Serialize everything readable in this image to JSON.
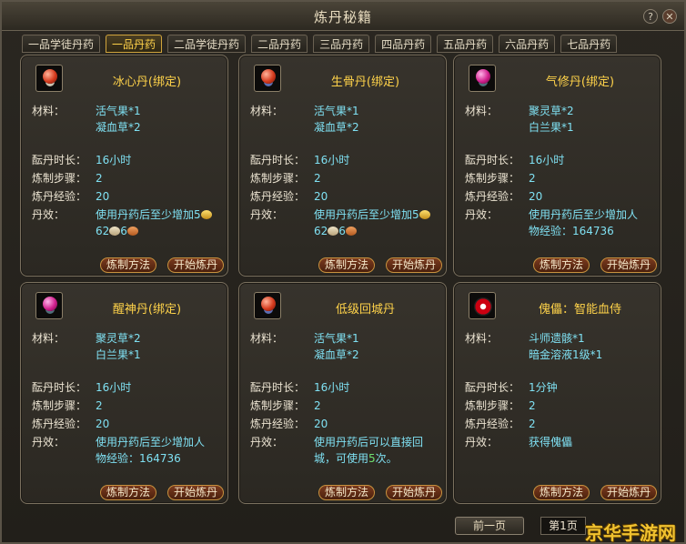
{
  "window": {
    "title": "炼丹秘籍"
  },
  "tabs": [
    {
      "label": "一品学徒丹药",
      "active": false
    },
    {
      "label": "一品丹药",
      "active": true
    },
    {
      "label": "二品学徒丹药",
      "active": false
    },
    {
      "label": "二品丹药",
      "active": false
    },
    {
      "label": "三品丹药",
      "active": false
    },
    {
      "label": "四品丹药",
      "active": false
    },
    {
      "label": "五品丹药",
      "active": false
    },
    {
      "label": "六品丹药",
      "active": false
    },
    {
      "label": "七品丹药",
      "active": false
    }
  ],
  "labels": {
    "materials": "材料：",
    "duration": "酝丹时长：",
    "steps": "炼制步骤：",
    "exp": "炼丹经验：",
    "effect": "丹效：",
    "method_button": "炼制方法",
    "start_button": "开始炼丹"
  },
  "recipes": [
    {
      "name": "冰心丹(绑定)",
      "icon": "red-pill-icon",
      "materials": [
        "活气果*1",
        "凝血草*2"
      ],
      "duration": "16小时",
      "steps": "2",
      "exp": "20",
      "effect_line1": "使用丹药后至少增加5",
      "effect_line2_a": "62",
      "effect_line2_b": "6"
    },
    {
      "name": "生骨丹(绑定)",
      "icon": "red-pill-icon",
      "materials": [
        "活气果*1",
        "凝血草*2"
      ],
      "duration": "16小时",
      "steps": "2",
      "exp": "20",
      "effect_line1": "使用丹药后至少增加5",
      "effect_line2_a": "62",
      "effect_line2_b": "6"
    },
    {
      "name": "气修丹(绑定)",
      "icon": "pink-pill-icon",
      "materials": [
        "聚灵草*2",
        "白兰果*1"
      ],
      "duration": "16小时",
      "steps": "2",
      "exp": "20",
      "effect_line1": "使用丹药后至少增加人",
      "effect_line2": "物经验：164736"
    },
    {
      "name": "醒神丹(绑定)",
      "icon": "pink-pill-icon",
      "materials": [
        "聚灵草*2",
        "白兰果*1"
      ],
      "duration": "16小时",
      "steps": "2",
      "exp": "20",
      "effect_line1": "使用丹药后至少增加人",
      "effect_line2": "物经验：164736"
    },
    {
      "name": "低级回城丹",
      "icon": "red-pill-icon",
      "materials": [
        "活气果*1",
        "凝血草*2"
      ],
      "duration": "16小时",
      "steps": "2",
      "exp": "20",
      "effect_line1": "使用丹药后可以直接回",
      "effect_line2_pre": "城，可使用",
      "effect_line2_hl": "5",
      "effect_line2_post": "次。"
    },
    {
      "name": "傀儡：智能血侍",
      "icon": "puppet-token-icon",
      "materials": [
        "斗师遗骸*1",
        "暗金溶液1级*1"
      ],
      "duration": "1分钟",
      "steps": "2",
      "exp": "2",
      "effect_line1": "获得傀儡"
    }
  ],
  "footer": {
    "prev_page": "前一页",
    "page": "第1页",
    "watermark": "京华手游网"
  }
}
